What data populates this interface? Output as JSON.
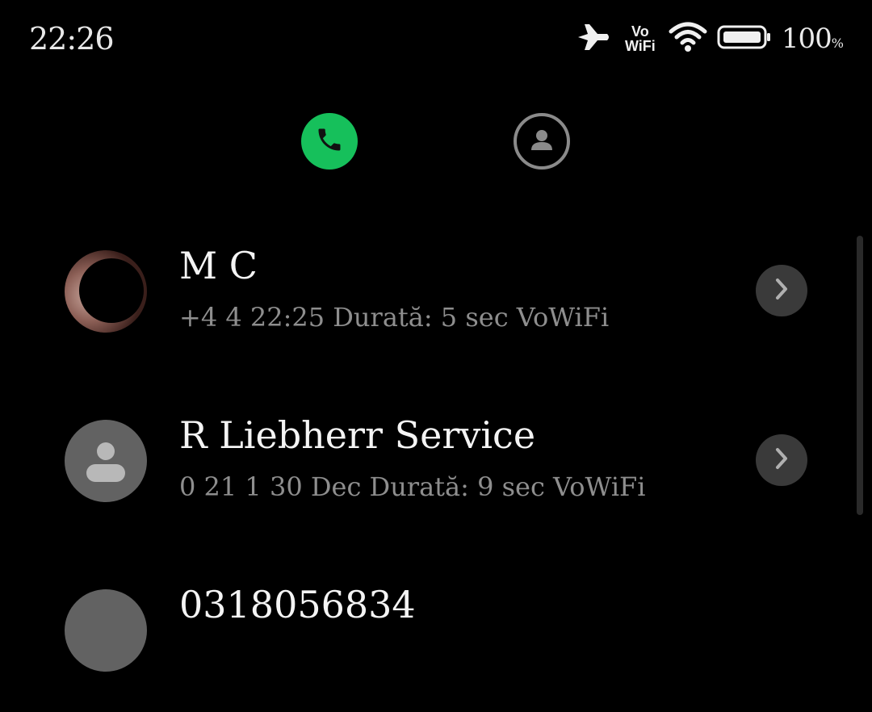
{
  "status_bar": {
    "time": "22:26",
    "vowifi_line1": "Vo",
    "vowifi_line2": "WiFi",
    "battery_percent": "100",
    "battery_unit": "%",
    "icons": [
      "airplane-mode-icon",
      "vowifi-icon",
      "wifi-icon",
      "battery-icon"
    ]
  },
  "tabs": [
    {
      "name": "phone",
      "icon": "phone-icon",
      "active": true,
      "color": "#16c05b"
    },
    {
      "name": "contacts",
      "icon": "contact-person-icon",
      "active": false,
      "color": "#8a8a8a"
    }
  ],
  "calls": [
    {
      "name": "M    C     ",
      "detail": "+4            4 22:25 Durată: 5 sec VoWiFi",
      "avatar": "photo"
    },
    {
      "name": "R     Liebherr Service",
      "detail": "0   21      1 30 Dec Durată: 9 sec VoWiFi",
      "avatar": "default"
    },
    {
      "name": "0318056834",
      "detail": "",
      "avatar": "default"
    }
  ],
  "colors": {
    "background": "#000000",
    "accent_green": "#16c05b",
    "secondary_text": "#8e8e8e"
  }
}
